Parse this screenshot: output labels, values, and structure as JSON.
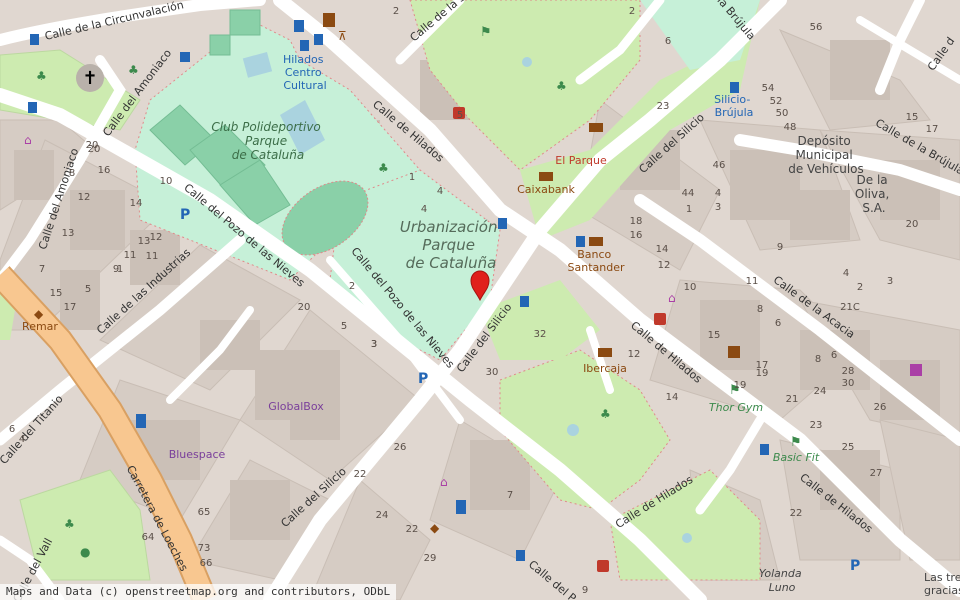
{
  "map": {
    "attribution": "Maps and Data (c) openstreetmap.org and contributors, ODbL",
    "colors": {
      "background": "#e0d7d0",
      "block": "#d9d0c9",
      "building": "#cfc5bd",
      "park": "#cdebb0",
      "leisure": "#c6f0d8",
      "pitch": "#8ad0a8",
      "water": "#aad3df",
      "road": "#ffffff",
      "major_road": "#f8c790",
      "major_road_casing": "#d9a062",
      "street_label": "#333333",
      "poi_label": "#8b4a12",
      "park_label": "#3c6e48",
      "transit_label": "#2366b5",
      "commercial_label": "#7a3f9b",
      "marker": "#e0201b"
    },
    "area_labels": [
      {
        "id": "club",
        "lines": [
          "Club Polideportivo",
          "Parque",
          "de Cataluña"
        ]
      },
      {
        "id": "urbanizacion",
        "lines": [
          "Urbanización",
          "Parque",
          "de Cataluña"
        ]
      },
      {
        "id": "deposito",
        "lines": [
          "Depósito",
          "Municipal",
          "de Vehículos"
        ]
      },
      {
        "id": "deloliva",
        "lines": [
          "De la",
          "Oliva,",
          "S.A."
        ]
      }
    ],
    "streets": [
      {
        "id": "circunvalacion",
        "name": "Calle de la Circunvalación"
      },
      {
        "id": "amoniaco-top",
        "name": "Calle del Amoniaco"
      },
      {
        "id": "amoniaco-left",
        "name": "Calle del Amoniaco"
      },
      {
        "id": "lasa",
        "name": "Calle de la S"
      },
      {
        "id": "brujula-top",
        "name": "de la Brújula"
      },
      {
        "id": "brujula-right",
        "name": "Calle de la Brújula"
      },
      {
        "id": "hilados-top",
        "name": "Calle de Hilados"
      },
      {
        "id": "hilados-mid",
        "name": "Calle de Hilados"
      },
      {
        "id": "hilados-bottom-right",
        "name": "Calle de Hilados"
      },
      {
        "id": "hilados-bottom",
        "name": "Calle de Hilados"
      },
      {
        "id": "silicio-top",
        "name": "Calle del Silicio"
      },
      {
        "id": "silicio-mid",
        "name": "Calle del Silicio"
      },
      {
        "id": "silicio-bottom",
        "name": "Calle del Silicio"
      },
      {
        "id": "pozo-1",
        "name": "Calle del Pozo de las Nieves"
      },
      {
        "id": "pozo-2",
        "name": "Calle del Pozo de las Nieves"
      },
      {
        "id": "industrias",
        "name": "Calle de las Industrias"
      },
      {
        "id": "titanio",
        "name": "Calle del Titanio"
      },
      {
        "id": "loeches",
        "name": "Carretera de Loeches"
      },
      {
        "id": "acacia",
        "name": "Calle de la Acacia"
      },
      {
        "id": "vall",
        "name": "Calle del Vall"
      },
      {
        "id": "calle-p",
        "name": "Calle del P"
      },
      {
        "id": "calle-c-right",
        "name": "Calle d"
      }
    ],
    "pois": [
      {
        "id": "hilados-centro-cultural",
        "lines": [
          "Hilados",
          "Centro",
          "Cultural"
        ],
        "kind": "transit"
      },
      {
        "id": "silicio-brujula",
        "lines": [
          "Silicio-",
          "Brújula"
        ],
        "kind": "transit"
      },
      {
        "id": "el-parque",
        "lines": [
          "El Parque"
        ],
        "kind": "poi"
      },
      {
        "id": "caixabank",
        "lines": [
          "Caixabank"
        ],
        "kind": "poi"
      },
      {
        "id": "banco-santander",
        "lines": [
          "Banco",
          "Santander"
        ],
        "kind": "poi"
      },
      {
        "id": "ibercaja",
        "lines": [
          "Ibercaja"
        ],
        "kind": "poi"
      },
      {
        "id": "thor-gym",
        "lines": [
          "Thor Gym"
        ],
        "kind": "park"
      },
      {
        "id": "basic-fit",
        "lines": [
          "Basic Fit"
        ],
        "kind": "park"
      },
      {
        "id": "remar",
        "lines": [
          "Remar"
        ],
        "kind": "poi"
      },
      {
        "id": "globalbox",
        "lines": [
          "GlobalBox"
        ],
        "kind": "commercial"
      },
      {
        "id": "bluespace",
        "lines": [
          "Bluespace"
        ],
        "kind": "commercial"
      },
      {
        "id": "yolanda-luno",
        "lines": [
          "Yolanda",
          "Luno"
        ],
        "kind": "plain"
      },
      {
        "id": "las-tres",
        "lines": [
          "Las tres",
          "gracias"
        ],
        "kind": "plain"
      }
    ],
    "house_numbers": [
      "2",
      "4",
      "5",
      "2",
      "6",
      "56",
      "54",
      "52",
      "50",
      "48",
      "15",
      "17",
      "23",
      "46",
      "44",
      "1",
      "4",
      "3",
      "20",
      "18",
      "16",
      "14",
      "12",
      "10",
      "8",
      "6",
      "4",
      "2",
      "9",
      "11",
      "15",
      "17",
      "3",
      "1",
      "4",
      "2",
      "1",
      "5",
      "3",
      "20",
      "16",
      "14",
      "12",
      "10",
      "7",
      "9",
      "11",
      "13",
      "15",
      "17",
      "19",
      "21",
      "23",
      "25",
      "27",
      "21C",
      "8",
      "6",
      "28",
      "30",
      "24",
      "26",
      "22",
      "32",
      "30",
      "12",
      "14",
      "26",
      "22",
      "20",
      "24",
      "22",
      "65",
      "73",
      "64",
      "66",
      "29",
      "9",
      "7",
      "6",
      "4",
      "11",
      "12",
      "20",
      "8",
      "13",
      "19",
      "5",
      "3"
    ]
  }
}
